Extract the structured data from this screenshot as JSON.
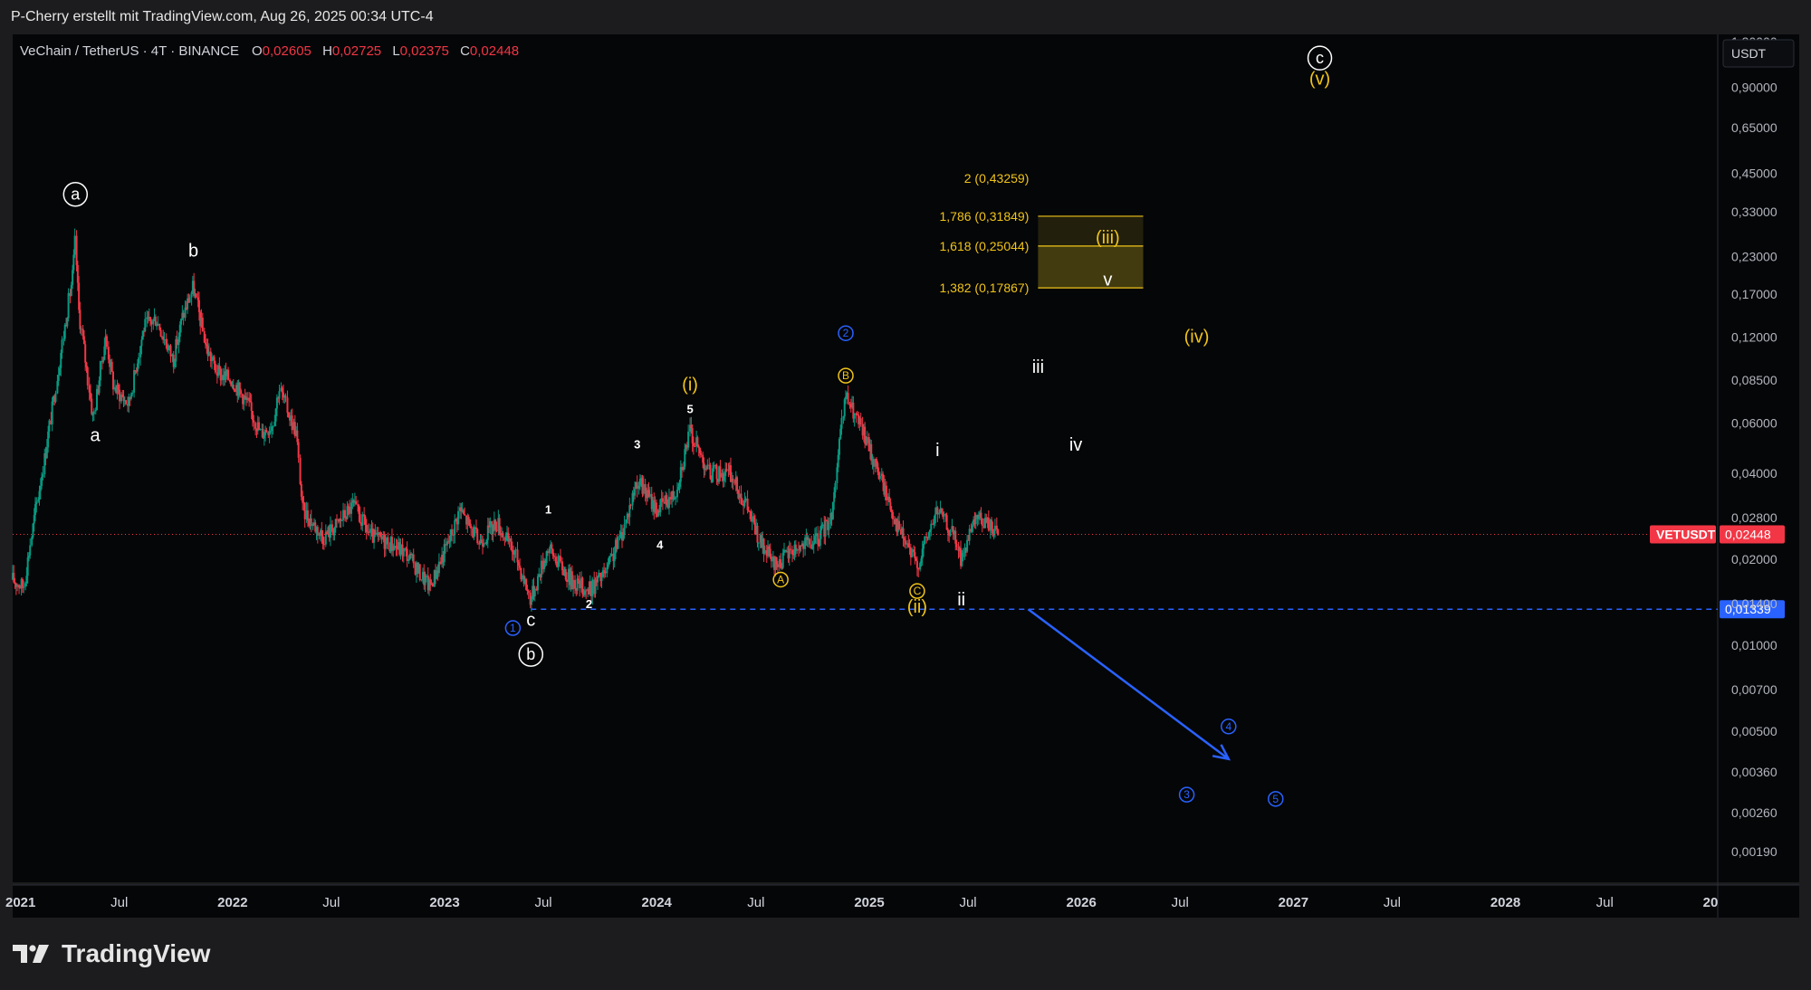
{
  "header": {
    "attribution": "P-Cherry erstellt mit TradingView.com, Aug 26, 2025 00:34 UTC-4"
  },
  "brand": {
    "name": "TradingView"
  },
  "chart_data": {
    "type": "candlestick",
    "title": "VeChain / TetherUS · 4T · BINANCE",
    "ohlc": {
      "o_label": "O",
      "o": "0,02605",
      "h_label": "H",
      "h": "0,02725",
      "l_label": "L",
      "l": "0,02375",
      "c_label": "C",
      "c": "0,02448"
    },
    "y_scale": "log",
    "y_unit": "USDT",
    "ylim": [
      0.00148,
      1.38
    ],
    "y_ticks": [
      "1,30000",
      "0,90000",
      "0,65000",
      "0,45000",
      "0,33000",
      "0,23000",
      "0,17000",
      "0,12000",
      "0,08500",
      "0,06000",
      "0,04000",
      "0,02800",
      "0,02000",
      "0,01400",
      "0,01000",
      "0,00700",
      "0,00500",
      "0,00360",
      "0,00260",
      "0,00190"
    ],
    "xlim": [
      "2021-01-01",
      "2028-12-31"
    ],
    "x_ticks": [
      {
        "label": "2021",
        "date": "2021-01-01",
        "bold": true
      },
      {
        "label": "Jul",
        "date": "2021-07-01",
        "bold": false
      },
      {
        "label": "2022",
        "date": "2022-01-01",
        "bold": true
      },
      {
        "label": "Jul",
        "date": "2022-07-01",
        "bold": false
      },
      {
        "label": "2023",
        "date": "2023-01-01",
        "bold": true
      },
      {
        "label": "Jul",
        "date": "2023-07-01",
        "bold": false
      },
      {
        "label": "2024",
        "date": "2024-01-01",
        "bold": true
      },
      {
        "label": "Jul",
        "date": "2024-07-01",
        "bold": false
      },
      {
        "label": "2025",
        "date": "2025-01-01",
        "bold": true
      },
      {
        "label": "Jul",
        "date": "2025-07-01",
        "bold": false
      },
      {
        "label": "2026",
        "date": "2026-01-01",
        "bold": true
      },
      {
        "label": "Jul",
        "date": "2026-07-01",
        "bold": false
      },
      {
        "label": "2027",
        "date": "2027-01-01",
        "bold": true
      },
      {
        "label": "Jul",
        "date": "2027-07-01",
        "bold": false
      },
      {
        "label": "2028",
        "date": "2028-01-01",
        "bold": true
      },
      {
        "label": "Jul",
        "date": "2028-07-01",
        "bold": false
      },
      {
        "label": "20",
        "date": "2029-01-01",
        "bold": true
      }
    ],
    "price_path": [
      [
        "2021-01-01",
        0.017
      ],
      [
        "2021-01-20",
        0.016
      ],
      [
        "2021-02-10",
        0.03
      ],
      [
        "2021-02-25",
        0.045
      ],
      [
        "2021-03-20",
        0.09
      ],
      [
        "2021-04-15",
        0.2
      ],
      [
        "2021-04-19",
        0.26
      ],
      [
        "2021-04-25",
        0.15
      ],
      [
        "2021-05-20",
        0.062
      ],
      [
        "2021-06-10",
        0.12
      ],
      [
        "2021-06-25",
        0.08
      ],
      [
        "2021-07-20",
        0.07
      ],
      [
        "2021-08-15",
        0.13
      ],
      [
        "2021-09-05",
        0.14
      ],
      [
        "2021-10-05",
        0.1
      ],
      [
        "2021-10-20",
        0.14
      ],
      [
        "2021-11-08",
        0.18
      ],
      [
        "2021-12-01",
        0.11
      ],
      [
        "2021-12-20",
        0.09
      ],
      [
        "2022-01-15",
        0.085
      ],
      [
        "2022-02-10",
        0.07
      ],
      [
        "2022-03-05",
        0.055
      ],
      [
        "2022-03-25",
        0.06
      ],
      [
        "2022-04-05",
        0.08
      ],
      [
        "2022-05-05",
        0.055
      ],
      [
        "2022-05-15",
        0.03
      ],
      [
        "2022-06-20",
        0.024
      ],
      [
        "2022-07-10",
        0.026
      ],
      [
        "2022-08-10",
        0.031
      ],
      [
        "2022-09-10",
        0.024
      ],
      [
        "2022-10-10",
        0.023
      ],
      [
        "2022-11-10",
        0.021
      ],
      [
        "2022-12-20",
        0.016
      ],
      [
        "2023-01-25",
        0.024
      ],
      [
        "2023-02-10",
        0.03
      ],
      [
        "2023-03-15",
        0.023
      ],
      [
        "2023-04-15",
        0.027
      ],
      [
        "2023-05-20",
        0.02
      ],
      [
        "2023-06-12",
        0.0145
      ],
      [
        "2023-07-12",
        0.022
      ],
      [
        "2023-08-20",
        0.017
      ],
      [
        "2023-09-20",
        0.0155
      ],
      [
        "2023-10-20",
        0.018
      ],
      [
        "2023-11-20",
        0.026
      ],
      [
        "2023-12-12",
        0.038
      ],
      [
        "2024-01-15",
        0.03
      ],
      [
        "2024-02-15",
        0.034
      ],
      [
        "2024-03-12",
        0.056
      ],
      [
        "2024-04-15",
        0.04
      ],
      [
        "2024-05-20",
        0.04
      ],
      [
        "2024-06-20",
        0.03
      ],
      [
        "2024-07-10",
        0.023
      ],
      [
        "2024-08-05",
        0.019
      ],
      [
        "2024-09-10",
        0.022
      ],
      [
        "2024-10-15",
        0.023
      ],
      [
        "2024-11-10",
        0.028
      ],
      [
        "2024-12-05",
        0.075
      ],
      [
        "2025-01-05",
        0.055
      ],
      [
        "2025-02-05",
        0.038
      ],
      [
        "2025-03-05",
        0.026
      ],
      [
        "2025-04-07",
        0.019
      ],
      [
        "2025-05-12",
        0.03
      ],
      [
        "2025-06-10",
        0.024
      ],
      [
        "2025-06-22",
        0.02
      ],
      [
        "2025-07-20",
        0.028
      ],
      [
        "2025-08-15",
        0.026
      ],
      [
        "2025-08-26",
        0.02448
      ]
    ],
    "current_price": {
      "symbol": "VETUSDT",
      "label": "0,02448",
      "value": 0.02448,
      "color": "#f23645"
    },
    "support_line": {
      "label": "0,01339",
      "value": 0.01339,
      "from": "2023-06-12",
      "color": "#2962ff"
    },
    "fib_levels": [
      {
        "label": "2 (0,43259)",
        "value": 0.43259
      },
      {
        "label": "1,786 (0,31849)",
        "value": 0.31849
      },
      {
        "label": "1,618 (0,25044)",
        "value": 0.25044
      },
      {
        "label": "1,382 (0,17867)",
        "value": 0.17867
      }
    ],
    "fib_box": {
      "from": "2025-11-01",
      "to": "2026-05-01",
      "color": "#f0c419"
    },
    "projection_arrow": {
      "from": [
        "2025-10-15",
        0.01339
      ],
      "to": [
        "2026-09-25",
        0.004
      ],
      "color": "#2962ff"
    },
    "wave_labels": [
      {
        "text": "a",
        "date": "2021-04-19",
        "price": 0.38,
        "style": "circle-white"
      },
      {
        "text": "a",
        "date": "2021-05-23",
        "price": 0.052,
        "style": "white"
      },
      {
        "text": "b",
        "date": "2021-11-08",
        "price": 0.23,
        "style": "white"
      },
      {
        "text": "c",
        "date": "2023-06-12",
        "price": 0.0117,
        "style": "white"
      },
      {
        "text": "b",
        "date": "2023-06-12",
        "price": 0.0093,
        "style": "circle-white"
      },
      {
        "text": "1",
        "date": "2023-05-12",
        "price": 0.0115,
        "style": "circle-blue"
      },
      {
        "text": "1",
        "date": "2023-07-12",
        "price": 0.029,
        "style": "white-small"
      },
      {
        "text": "2",
        "date": "2023-09-20",
        "price": 0.0135,
        "style": "white-small"
      },
      {
        "text": "3",
        "date": "2023-12-12",
        "price": 0.049,
        "style": "white-small"
      },
      {
        "text": "4",
        "date": "2024-01-20",
        "price": 0.0218,
        "style": "white-small"
      },
      {
        "text": "5",
        "date": "2024-03-12",
        "price": 0.065,
        "style": "white-small"
      },
      {
        "text": "(i)",
        "date": "2024-03-12",
        "price": 0.078,
        "style": "yellow"
      },
      {
        "text": "A",
        "date": "2024-08-15",
        "price": 0.017,
        "style": "circle-yellow"
      },
      {
        "text": "B",
        "date": "2024-12-05",
        "price": 0.088,
        "style": "circle-yellow"
      },
      {
        "text": "2",
        "date": "2024-12-05",
        "price": 0.124,
        "style": "circle-blue"
      },
      {
        "text": "C",
        "date": "2025-04-07",
        "price": 0.0155,
        "style": "circle-yellow"
      },
      {
        "text": "(ii)",
        "date": "2025-04-07",
        "price": 0.013,
        "style": "yellow"
      },
      {
        "text": "i",
        "date": "2025-05-12",
        "price": 0.046,
        "style": "white"
      },
      {
        "text": "ii",
        "date": "2025-06-22",
        "price": 0.0138,
        "style": "white"
      },
      {
        "text": "iii",
        "date": "2025-11-01",
        "price": 0.09,
        "style": "white"
      },
      {
        "text": "iv",
        "date": "2026-01-05",
        "price": 0.048,
        "style": "white"
      },
      {
        "text": "(iii)",
        "date": "2026-03-01",
        "price": 0.256,
        "style": "yellow"
      },
      {
        "text": "v",
        "date": "2026-03-01",
        "price": 0.182,
        "style": "white"
      },
      {
        "text": "(iv)",
        "date": "2026-08-01",
        "price": 0.115,
        "style": "yellow"
      },
      {
        "text": "c",
        "date": "2027-03-01",
        "price": 1.14,
        "style": "circle-white"
      },
      {
        "text": "(v)",
        "date": "2027-03-01",
        "price": 0.92,
        "style": "yellow"
      },
      {
        "text": "3",
        "date": "2026-07-15",
        "price": 0.003,
        "style": "circle-blue"
      },
      {
        "text": "4",
        "date": "2026-09-25",
        "price": 0.0052,
        "style": "circle-blue"
      },
      {
        "text": "5",
        "date": "2026-12-15",
        "price": 0.0029,
        "style": "circle-blue"
      }
    ]
  }
}
